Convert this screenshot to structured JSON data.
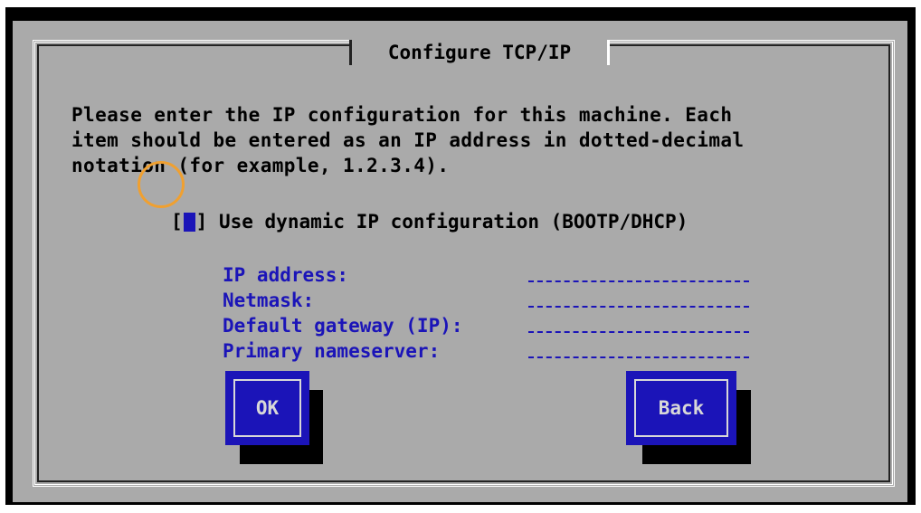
{
  "dialog": {
    "title": "Configure TCP/IP",
    "description_lines": [
      "Please enter the IP configuration for this machine. Each",
      "item should be entered as an IP address in dotted-decimal",
      "notation (for example, 1.2.3.4)."
    ],
    "checkbox": {
      "left_bracket": "[",
      "right_bracket": "]",
      "label": "Use dynamic IP configuration (BOOTP/DHCP)",
      "checked": true
    },
    "fields": [
      {
        "label": "IP address:",
        "value": ""
      },
      {
        "label": "Netmask:",
        "value": ""
      },
      {
        "label": "Default gateway (IP):",
        "value": ""
      },
      {
        "label": "Primary nameserver:",
        "value": ""
      }
    ],
    "buttons": {
      "ok": "OK",
      "back": "Back"
    }
  },
  "colors": {
    "dialog_bg": "#aaaaaa",
    "accent_blue": "#1b14b8",
    "highlight_ring": "#f0a030"
  }
}
